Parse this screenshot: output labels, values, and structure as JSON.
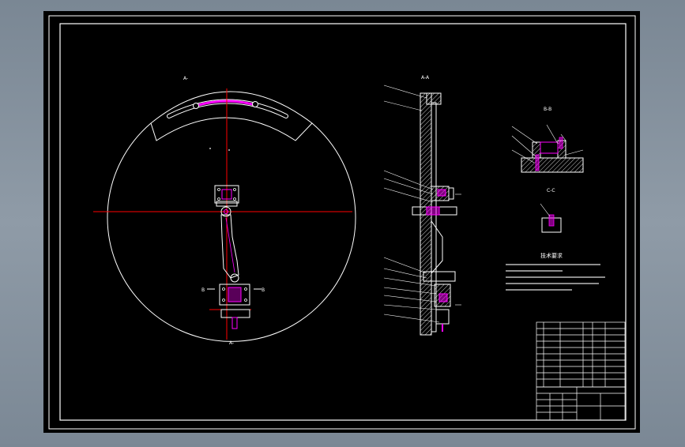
{
  "colors": {
    "background": "#000000",
    "viewport_bg": "#8592a0",
    "line": "#ffffff",
    "centerline": "#ff0000",
    "part": "#ff00ff",
    "hatch": "#ffffff"
  },
  "views": {
    "main_label": "A-",
    "section_label": "A-A",
    "b_label": "B-B",
    "c_label": "C-C",
    "arrow_bottom": "A-",
    "b_marker_left": "B",
    "b_marker_right": "B"
  },
  "notes": {
    "title": "技术要求"
  }
}
